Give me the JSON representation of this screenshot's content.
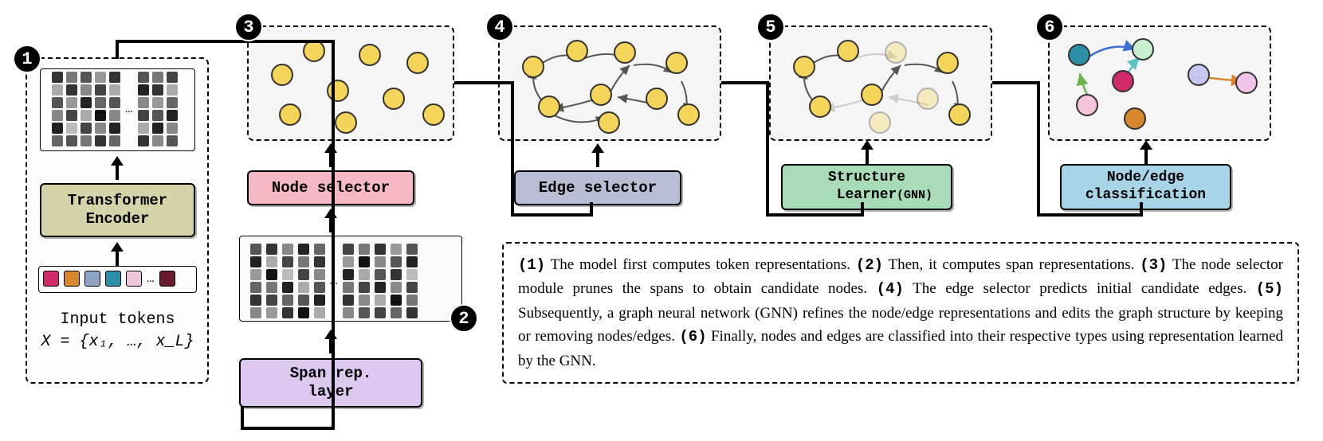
{
  "badges": {
    "b1": "1",
    "b2": "2",
    "b3": "3",
    "b4": "4",
    "b5": "5",
    "b6": "6"
  },
  "labels": {
    "input_tokens": "Input tokens",
    "input_formula": "X = {x₁, …, x_L}",
    "transformer": "Transformer\nEncoder",
    "span_rep": "Span rep.\nlayer",
    "node_sel": "Node selector",
    "edge_sel": "Edge selector",
    "struct": "Structure\nLearner",
    "gnn": "(GNN)",
    "classif": "Node/edge\nclassification"
  },
  "desc": {
    "s1a": "(1)",
    "s1b": " The model first computes token representations. ",
    "s2a": "(2)",
    "s2b": " Then, it computes span representations. ",
    "s3a": "(3)",
    "s3b": " The node selector module prunes the spans to obtain candidate nodes. ",
    "s4a": "(4)",
    "s4b": " The edge selector predicts initial candidate edges. ",
    "s5a": "(5)",
    "s5b": " Subsequently, a graph neural network (GNN) refines the node/edge representations and edits the graph structure by keeping or removing nodes/edges. ",
    "s6a": "(6)",
    "s6b": " Finally, nodes and edges are classified into their respective types using representation learned by the GNN."
  },
  "colors": {
    "transformer_bg": "#d4d4a8",
    "span_bg": "#ddc9f0",
    "node_sel_bg": "#f5b8c4",
    "edge_sel_bg": "#b8bdd4",
    "struct_bg": "#a8dcb8",
    "classif_bg": "#a8d4e8",
    "node_yellow": "#f5d45a"
  },
  "tokens": [
    "#d12a6b",
    "#d9872b",
    "#8fa3c4",
    "#2b8fa8",
    "#f0c4d9",
    "#6b1a2b"
  ]
}
